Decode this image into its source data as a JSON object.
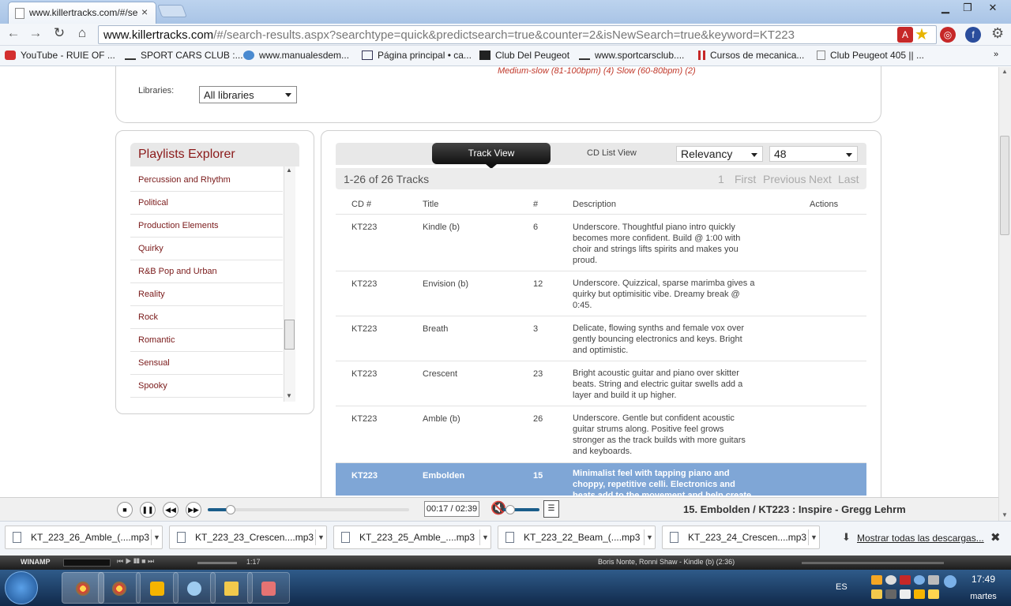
{
  "browser": {
    "tab_title": "www.killertracks.com/#/se",
    "tab_close": "×",
    "url_host": "www.killertracks.com",
    "url_path": "/#/search-results.aspx?searchtype=quick&predictsearch=true&counter=2&isNewSearch=true&keyword=KT223",
    "bookmarks": [
      "YouTube - RUIE OF ...",
      "SPORT CARS CLUB :...",
      "www.manualesdem...",
      "Página principal • ca...",
      "Club Del Peugeot",
      "www.sportcarsclub....",
      "Cursos de mecanica...",
      "Club Peugeot 405 || ..."
    ]
  },
  "page": {
    "tempo_filters": "Medium-slow (81-100bpm) (4)   Slow (60-80bpm) (2)",
    "libraries_label": "Libraries:",
    "libraries_value": "All libraries",
    "playlists_title": "Playlists Explorer",
    "playlists": [
      "Percussion and Rhythm",
      "Political",
      "Production Elements",
      "Quirky",
      "R&B Pop and Urban",
      "Reality",
      "Rock",
      "Romantic",
      "Sensual",
      "Spooky"
    ],
    "track_view_label": "Track View",
    "cd_list_view_label": "CD List View",
    "sort_value": "Relevancy",
    "per_page_value": "48",
    "count_text": "1-26 of 26 Tracks",
    "pager": {
      "page": "1",
      "first": "First",
      "previous": "Previous",
      "next": "Next",
      "last": "Last"
    },
    "columns": {
      "cd": "CD #",
      "title": "Title",
      "num": "#",
      "description": "Description",
      "actions": "Actions"
    },
    "tracks": [
      {
        "cd": "KT223",
        "title": "Kindle (b)",
        "num": "6",
        "description": "Underscore. Thoughtful piano intro quickly becomes more confident. Build @ 1:00 with choir and strings lifts spirits and makes you proud."
      },
      {
        "cd": "KT223",
        "title": "Envision (b)",
        "num": "12",
        "description": "Underscore. Quizzical, sparse marimba gives a quirky but optimisitic vibe. Dreamy break @ 0:45."
      },
      {
        "cd": "KT223",
        "title": "Breath",
        "num": "3",
        "description": "Delicate, flowing synths and female vox over gently bouncing electronics and keys. Bright and optimistic."
      },
      {
        "cd": "KT223",
        "title": "Crescent",
        "num": "23",
        "description": "Bright acoustic guitar and piano over skitter beats. String and electric guitar swells add a layer and build it up higher."
      },
      {
        "cd": "KT223",
        "title": "Amble (b)",
        "num": "26",
        "description": "Underscore. Gentle but confident acoustic guitar strums along. Positive feel grows stronger as the track builds with more guitars and keyboards."
      },
      {
        "cd": "KT223",
        "title": "Embolden",
        "num": "15",
        "description": "Minimalist feel with tapping piano and choppy, repetitive celli. Electronics and beats add to the movement and help create a sense of wonder."
      }
    ]
  },
  "player": {
    "time": "00:17 / 02:39",
    "progress": 0.107,
    "now_playing": "15. Embolden / KT223 : Inspire - Gregg Lehrm"
  },
  "downloads": {
    "files": [
      "KT_223_26_Amble_(....mp3",
      "KT_223_23_Crescen....mp3",
      "KT_223_25_Amble_....mp3",
      "KT_223_22_Beam_(....mp3",
      "KT_223_24_Crescen....mp3"
    ],
    "show_all": "Mostrar todas las descargas..."
  },
  "winamp": {
    "logo": "WINAMP",
    "time": "1:17",
    "song": "Boris Nonte, Ronni Shaw  - Kindle (b) (2:36)"
  },
  "taskbar": {
    "language": "ES",
    "clock": "17:49",
    "day": "martes"
  }
}
